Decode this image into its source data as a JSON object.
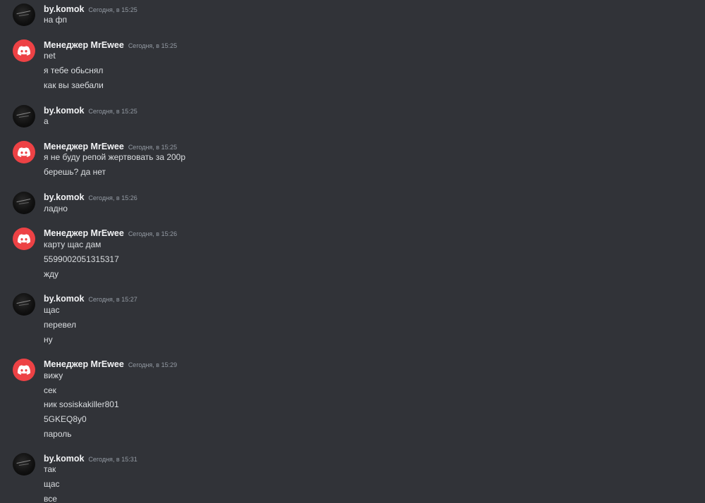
{
  "colors": {
    "background": "#313338",
    "username": "#f2f3f5",
    "timestamp": "#949ba4",
    "text": "#dbdee1",
    "discord_avatar": "#ed4245"
  },
  "messages": [
    {
      "author": "by.komok",
      "avatar": "user-avatar-dark",
      "timestamp": "Сегодня, в 15:25",
      "lines": [
        "на фп"
      ]
    },
    {
      "author": "Менеджер MrEwee",
      "avatar": "discord-logo-icon",
      "timestamp": "Сегодня, в 15:25",
      "lines": [
        "net",
        "я тебе обьснял",
        "как вы заебали"
      ]
    },
    {
      "author": "by.komok",
      "avatar": "user-avatar-dark",
      "timestamp": "Сегодня, в 15:25",
      "lines": [
        "а"
      ]
    },
    {
      "author": "Менеджер MrEwee",
      "avatar": "discord-logo-icon",
      "timestamp": "Сегодня, в 15:25",
      "lines": [
        "я не буду репой жертвовать за 200р",
        "берешь? да нет"
      ]
    },
    {
      "author": "by.komok",
      "avatar": "user-avatar-dark",
      "timestamp": "Сегодня, в 15:26",
      "lines": [
        "ладно"
      ]
    },
    {
      "author": "Менеджер MrEwee",
      "avatar": "discord-logo-icon",
      "timestamp": "Сегодня, в 15:26",
      "lines": [
        "карту щас дам",
        "5599002051315317",
        "жду"
      ]
    },
    {
      "author": "by.komok",
      "avatar": "user-avatar-dark",
      "timestamp": "Сегодня, в 15:27",
      "lines": [
        "щас",
        "перевел",
        "ну"
      ]
    },
    {
      "author": "Менеджер MrEwee",
      "avatar": "discord-logo-icon",
      "timestamp": "Сегодня, в 15:29",
      "lines": [
        "вижу",
        "сек",
        "ник sosiskakiller801",
        "5GKEQ8y0",
        "пароль"
      ]
    },
    {
      "author": "by.komok",
      "avatar": "user-avatar-dark",
      "timestamp": "Сегодня, в 15:31",
      "lines": [
        "так",
        "щас",
        "все"
      ]
    }
  ]
}
